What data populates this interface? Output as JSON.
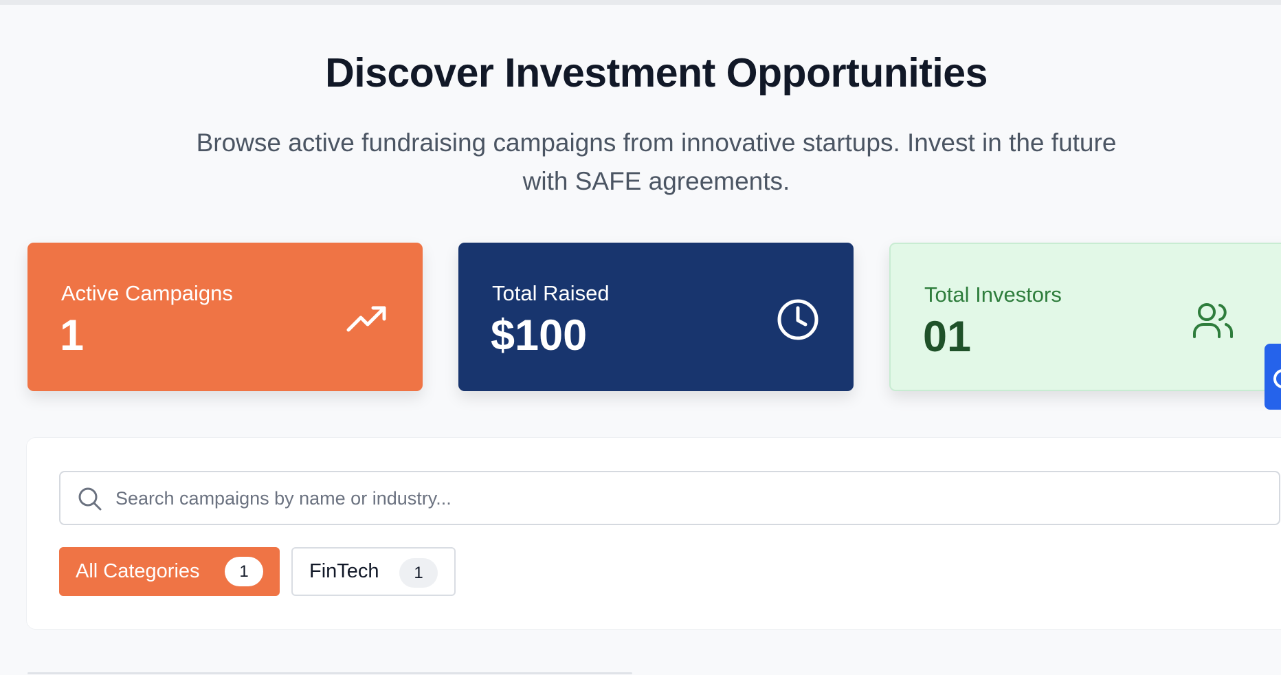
{
  "hero": {
    "title": "Discover Investment Opportunities",
    "subtitle": "Browse active fundraising campaigns from innovative startups. Invest in the future with SAFE agreements."
  },
  "stats": [
    {
      "label": "Active Campaigns",
      "value": "1",
      "icon": "trending-up-icon",
      "color": "#ef7445"
    },
    {
      "label": "Total Raised",
      "value": "$100",
      "icon": "clock-icon",
      "color": "#18356e"
    },
    {
      "label": "Total Investors",
      "value": "01",
      "icon": "users-icon",
      "color": "#e2f8e7"
    }
  ],
  "search": {
    "placeholder": "Search campaigns by name or industry...",
    "value": ""
  },
  "categories": [
    {
      "label": "All Categories",
      "count": "1",
      "active": true
    },
    {
      "label": "FinTech",
      "count": "1",
      "active": false
    }
  ],
  "colors": {
    "accent": "#ef7445",
    "navy": "#18356e",
    "green_bg": "#e2f8e7",
    "floating_button": "#2563eb"
  }
}
